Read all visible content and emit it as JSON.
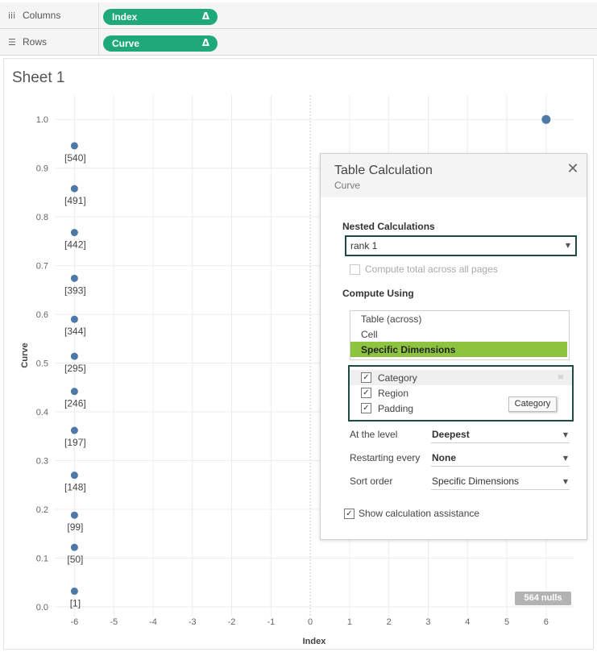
{
  "shelves": {
    "columns": {
      "label": "Columns",
      "icon": "columns-icon",
      "pill": "Index",
      "pill_mark": "Δ"
    },
    "rows": {
      "label": "Rows",
      "icon": "rows-icon",
      "pill": "Curve",
      "pill_mark": "Δ"
    },
    "pill_color": "#1fa97a"
  },
  "sheet": {
    "title": "Sheet 1"
  },
  "chart_data": {
    "type": "scatter",
    "xlabel": "Index",
    "ylabel": "Curve",
    "xlim": [
      -6.5,
      6.7
    ],
    "ylim": [
      -0.02,
      1.05
    ],
    "x_ticks": [
      "-6",
      "-5",
      "-4",
      "-3",
      "-2",
      "-1",
      "0",
      "1",
      "2",
      "3",
      "4",
      "5",
      "6"
    ],
    "y_ticks": [
      "0.0",
      "0.1",
      "0.2",
      "0.3",
      "0.4",
      "0.5",
      "0.6",
      "0.7",
      "0.8",
      "0.9",
      "1.0"
    ],
    "grid": true,
    "point_color": "#4e79a7",
    "points": [
      {
        "x": -6,
        "y": 0.946,
        "label": "[540]"
      },
      {
        "x": -6,
        "y": 0.858,
        "label": "[491]"
      },
      {
        "x": -6,
        "y": 0.768,
        "label": "[442]"
      },
      {
        "x": -6,
        "y": 0.674,
        "label": "[393]"
      },
      {
        "x": -6,
        "y": 0.59,
        "label": "[344]"
      },
      {
        "x": -6,
        "y": 0.514,
        "label": "[295]"
      },
      {
        "x": -6,
        "y": 0.442,
        "label": "[246]"
      },
      {
        "x": -6,
        "y": 0.362,
        "label": "[197]"
      },
      {
        "x": -6,
        "y": 0.27,
        "label": "[148]"
      },
      {
        "x": -6,
        "y": 0.188,
        "label": "[99]"
      },
      {
        "x": -6,
        "y": 0.122,
        "label": "[50]"
      },
      {
        "x": -6,
        "y": 0.032,
        "label": "[1]"
      },
      {
        "x": 6,
        "y": 1.0,
        "label": ""
      }
    ]
  },
  "nulls_badge": "564 nulls",
  "panel": {
    "title": "Table Calculation",
    "subtitle": "Curve",
    "close_icon": "close-icon",
    "nested_label": "Nested Calculations",
    "nested_value": "rank 1",
    "compute_total_label": "Compute total across all pages",
    "compute_using_label": "Compute Using",
    "compute_options": [
      "Table (across)",
      "Cell",
      "Specific Dimensions"
    ],
    "selected_option": "Specific Dimensions",
    "selected_color": "#8cc43f",
    "dimensions": [
      {
        "label": "Category",
        "checked": true
      },
      {
        "label": "Region",
        "checked": true
      },
      {
        "label": "Padding",
        "checked": true
      }
    ],
    "drag_tooltip": "Category",
    "at_level_label": "At the level",
    "at_level_value": "Deepest",
    "restarting_label": "Restarting every",
    "restarting_value": "None",
    "sort_label": "Sort order",
    "sort_value": "Specific Dimensions",
    "assist_label": "Show calculation assistance",
    "assist_checked": true
  }
}
